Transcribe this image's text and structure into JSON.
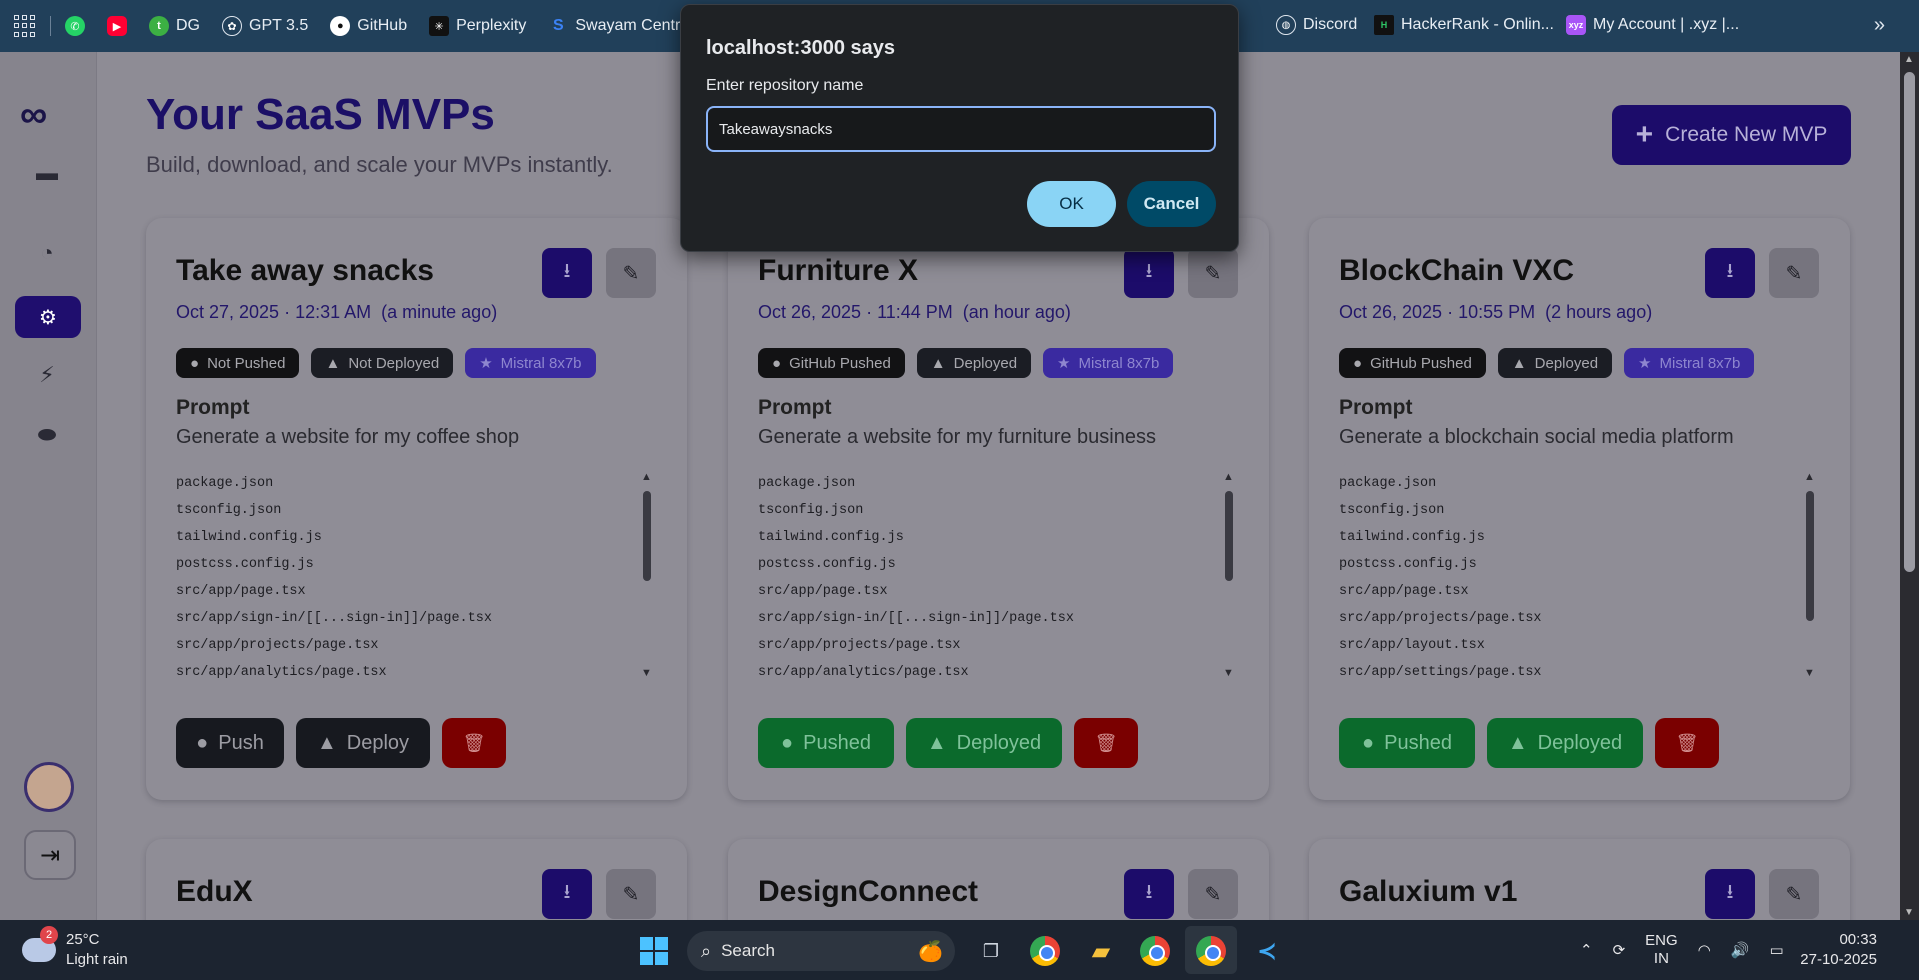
{
  "bookmarks": [
    {
      "label": "",
      "icon": "whatsapp-icon",
      "color": "#25d366"
    },
    {
      "label": "",
      "icon": "youtube-icon",
      "color": "#ff0033"
    },
    {
      "label": "DG",
      "icon": "dg-icon",
      "color": "#3cb043"
    },
    {
      "label": "GPT 3.5",
      "icon": "openai-icon",
      "color": "#dfe6ee"
    },
    {
      "label": "GitHub",
      "icon": "github-icon",
      "color": "#ffffff"
    },
    {
      "label": "Perplexity",
      "icon": "perplexity-icon",
      "color": "#dfe6ee"
    },
    {
      "label": "Swayam Central",
      "icon": "swayam-icon",
      "color": "#3b82f6"
    },
    {
      "label": "Discord",
      "icon": "globe-icon",
      "color": "#dfe6ee"
    },
    {
      "label": "HackerRank - Onlin...",
      "icon": "hackerrank-icon",
      "color": "#2ec866"
    },
    {
      "label": "My Account | .xyz |...",
      "icon": "xyz-icon",
      "color": "#a855f7"
    }
  ],
  "page": {
    "title": "Your SaaS MVPs",
    "subtitle": "Build, download, and scale your MVPs instantly.",
    "create_button": "Create New MVP"
  },
  "cards": [
    {
      "title": "Take away snacks",
      "date": "Oct 27, 2025 · 12:31 AM",
      "ago": "(a minute ago)",
      "badges": [
        "Not Pushed",
        "Not Deployed",
        "Mistral 8x7b"
      ],
      "prompt_label": "Prompt",
      "prompt": "Generate a website for my coffee shop",
      "files": [
        "package.json",
        "tsconfig.json",
        "tailwind.config.js",
        "postcss.config.js",
        "src/app/page.tsx",
        "src/app/sign-in/[[...sign-in]]/page.tsx",
        "src/app/projects/page.tsx",
        "src/app/analytics/page.tsx"
      ],
      "push": "Push",
      "deploy": "Deploy",
      "style": "dark"
    },
    {
      "title": "Furniture X",
      "date": "Oct 26, 2025 · 11:44 PM",
      "ago": "(an hour ago)",
      "badges": [
        "GitHub Pushed",
        "Deployed",
        "Mistral 8x7b"
      ],
      "prompt_label": "Prompt",
      "prompt": "Generate a website for my furniture business",
      "files": [
        "package.json",
        "tsconfig.json",
        "tailwind.config.js",
        "postcss.config.js",
        "src/app/page.tsx",
        "src/app/sign-in/[[...sign-in]]/page.tsx",
        "src/app/projects/page.tsx",
        "src/app/analytics/page.tsx"
      ],
      "push": "Pushed",
      "deploy": "Deployed",
      "style": "green"
    },
    {
      "title": "BlockChain VXC",
      "date": "Oct 26, 2025 · 10:55 PM",
      "ago": "(2 hours ago)",
      "badges": [
        "GitHub Pushed",
        "Deployed",
        "Mistral 8x7b"
      ],
      "prompt_label": "Prompt",
      "prompt": "Generate a blockchain social media platform",
      "files": [
        "package.json",
        "tsconfig.json",
        "tailwind.config.js",
        "postcss.config.js",
        "src/app/page.tsx",
        "src/app/projects/page.tsx",
        "src/app/layout.tsx",
        "src/app/settings/page.tsx"
      ],
      "push": "Pushed",
      "deploy": "Deployed",
      "style": "green"
    }
  ],
  "cards_row2": [
    "EduX",
    "DesignConnect",
    "Galuxium v1"
  ],
  "dialog": {
    "title": "localhost:3000 says",
    "message": "Enter repository name",
    "value": "Takeawaysnacks",
    "ok": "OK",
    "cancel": "Cancel"
  },
  "taskbar": {
    "weather_badge": "2",
    "temperature": "25°C",
    "condition": "Light rain",
    "search_label": "Search",
    "lang_top": "ENG",
    "lang_bottom": "IN",
    "time": "00:33",
    "date": "27-10-2025"
  }
}
